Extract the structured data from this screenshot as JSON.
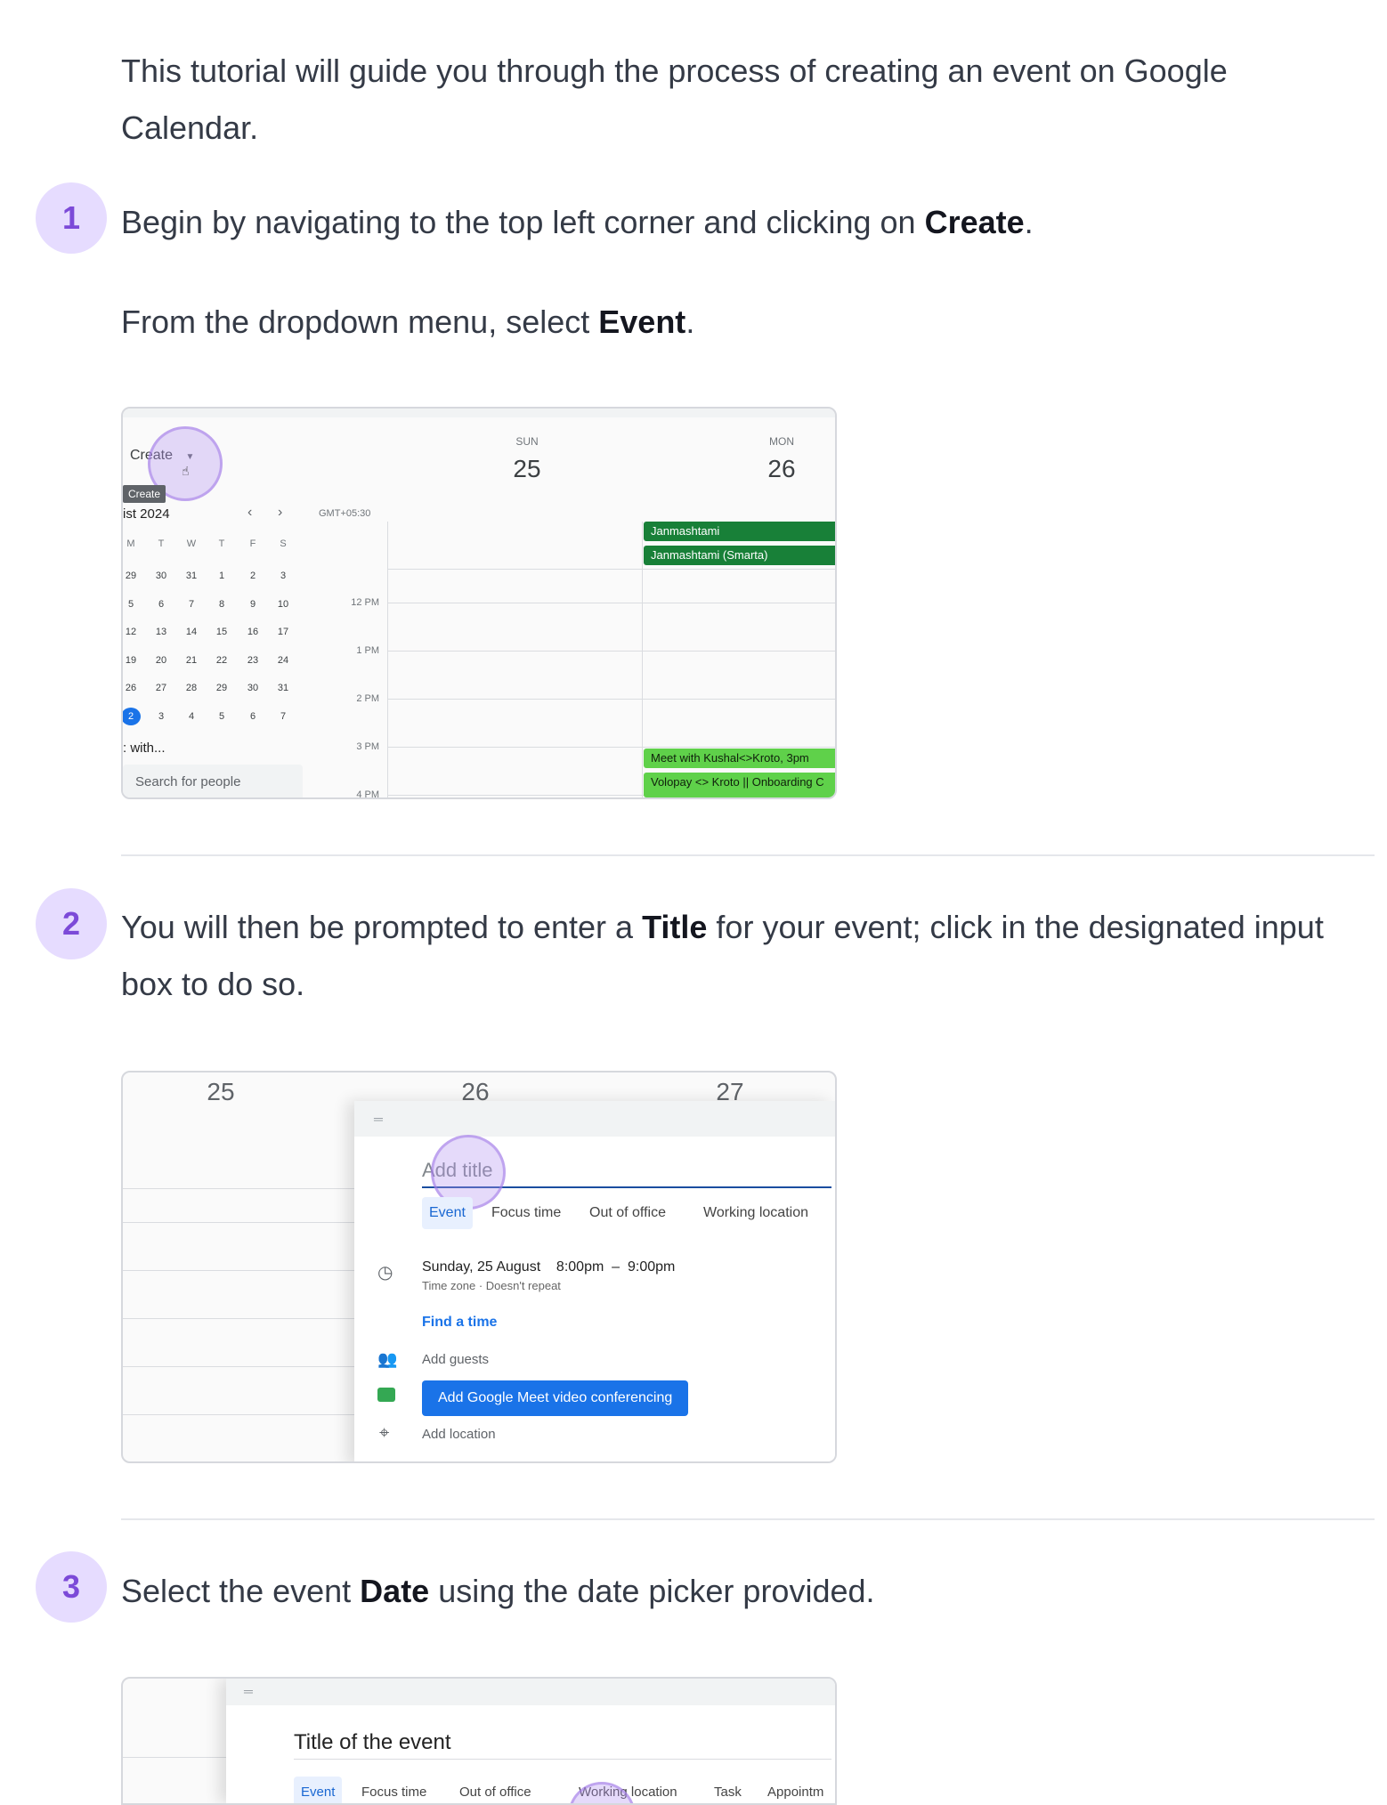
{
  "intro": "This tutorial will guide you through the process of creating an event on Google Calendar.",
  "steps": [
    {
      "number": "1",
      "line1_pre": "Begin by navigating to the top left corner and clicking on ",
      "line1_bold": "Create",
      "line1_post": ".",
      "line2_pre": "From the dropdown menu, select ",
      "line2_bold": "Event",
      "line2_post": "."
    },
    {
      "number": "2",
      "pre": "You will then be prompted to enter a ",
      "bold": "Title",
      "post": " for your event; click in the designated input box to do so."
    },
    {
      "number": "3",
      "pre": "Select the event ",
      "bold": "Date",
      "post": " using the date picker provided."
    }
  ],
  "shot1": {
    "create_label": "Create",
    "tooltip": "Create",
    "month": "ist 2024",
    "timezone": "GMT+05:30",
    "day1_name": "SUN",
    "day1_num": "25",
    "day2_name": "MON",
    "day2_num": "26",
    "weekdays": [
      "M",
      "T",
      "W",
      "T",
      "F",
      "S"
    ],
    "weeks": [
      [
        "29",
        "30",
        "31",
        "1",
        "2",
        "3"
      ],
      [
        "5",
        "6",
        "7",
        "8",
        "9",
        "10"
      ],
      [
        "12",
        "13",
        "14",
        "15",
        "16",
        "17"
      ],
      [
        "19",
        "20",
        "21",
        "22",
        "23",
        "24"
      ],
      [
        "26",
        "27",
        "28",
        "29",
        "30",
        "31"
      ],
      [
        "2",
        "3",
        "4",
        "5",
        "6",
        "7"
      ]
    ],
    "times": [
      "12 PM",
      "1 PM",
      "2 PM",
      "3 PM",
      "4 PM"
    ],
    "meet_with": ": with...",
    "search_people": "Search for people",
    "events": [
      "Janmashtami",
      "Janmashtami (Smarta)",
      "Meet with Kushal<>Kroto, 3pm",
      "Volopay <> Kroto || Onboarding C"
    ],
    "colors": {
      "holiday": "#188038",
      "meeting": "#5fd14a",
      "today": "#1a73e8"
    }
  },
  "shot2": {
    "days": [
      "25",
      "26",
      "27"
    ],
    "title_placeholder": "Add title",
    "tabs": [
      "Event",
      "Focus time",
      "Out of office",
      "Working location"
    ],
    "date_line": "Sunday, 25 August    8:00pm  –  9:00pm",
    "date_sub": "Time zone · Doesn't repeat",
    "find_time": "Find a time",
    "add_guests": "Add guests",
    "meet_button": "Add Google Meet video conferencing",
    "add_location": "Add location"
  },
  "shot3": {
    "title_value": "Title of the event",
    "tabs": [
      "Event",
      "Focus time",
      "Out of office",
      "Working location",
      "Task",
      "Appointm"
    ]
  }
}
